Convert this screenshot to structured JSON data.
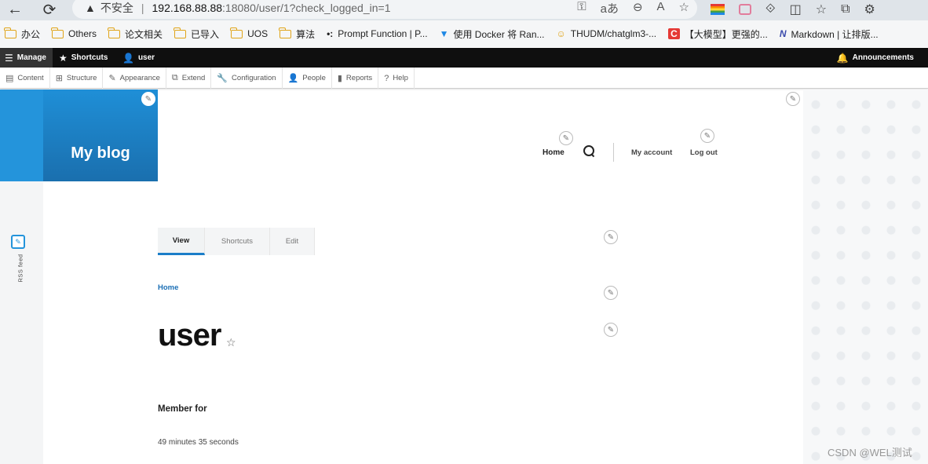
{
  "browser": {
    "back_icon": "←",
    "reload_icon": "⟳",
    "warning_icon": "▲",
    "insecure_label": "不安全",
    "separator": "|",
    "url_host": "192.168.88.88",
    "url_rest": ":18080/user/1?check_logged_in=1",
    "addr_icons": [
      "key-icon",
      "translate-icon",
      "zoom-out-icon",
      "read-aloud-icon",
      "favorite-star-icon"
    ],
    "addr_icon_glyphs": [
      "⚿",
      "aあ",
      "⊖",
      "A",
      "☆"
    ],
    "ext_icon_glyphs": [
      "⟐",
      "◫",
      "☆",
      "⧉",
      "⚙"
    ]
  },
  "bookmarks": [
    {
      "label": "办公",
      "type": "folder"
    },
    {
      "label": "Others",
      "type": "folder"
    },
    {
      "label": "论文相关",
      "type": "folder"
    },
    {
      "label": "已导入",
      "type": "folder"
    },
    {
      "label": "UOS",
      "type": "folder"
    },
    {
      "label": "算法",
      "type": "folder"
    },
    {
      "label": "Prompt Function | P...",
      "type": "link",
      "icon": "•:"
    },
    {
      "label": "使用 Docker 将 Ran...",
      "type": "link",
      "icon": "▼"
    },
    {
      "label": "THUDM/chatglm3-...",
      "type": "link",
      "icon": "☺"
    },
    {
      "label": "【大模型】更强的...",
      "type": "link",
      "icon": "C"
    },
    {
      "label": "Markdown | 让排版...",
      "type": "link",
      "icon": "N"
    }
  ],
  "toolbar": {
    "manage": "Manage",
    "shortcuts": "Shortcuts",
    "user": "user",
    "announcements": "Announcements"
  },
  "tray": [
    {
      "label": "Content",
      "icon": "▤"
    },
    {
      "label": "Structure",
      "icon": "⊞"
    },
    {
      "label": "Appearance",
      "icon": "✎"
    },
    {
      "label": "Extend",
      "icon": "⧉"
    },
    {
      "label": "Configuration",
      "icon": "🔧"
    },
    {
      "label": "People",
      "icon": "👤"
    },
    {
      "label": "Reports",
      "icon": "▮"
    },
    {
      "label": "Help",
      "icon": "?"
    }
  ],
  "site": {
    "name": "My blog"
  },
  "main_nav": {
    "home": "Home",
    "my_account": "My account",
    "log_out": "Log out"
  },
  "rss": {
    "label": "RSS feed"
  },
  "tabs": [
    {
      "label": "View",
      "active": true
    },
    {
      "label": "Shortcuts",
      "active": false
    },
    {
      "label": "Edit",
      "active": false
    }
  ],
  "breadcrumb": {
    "home": "Home"
  },
  "page": {
    "title": "user",
    "member_label": "Member for",
    "member_value": "49 minutes 35 seconds"
  },
  "watermark": "CSDN @WEL测试",
  "colors": {
    "brand_blue": "#1f8fd7",
    "toolbar_black": "#0f0f0f",
    "tab_active_underline": "#1b7ec8"
  }
}
